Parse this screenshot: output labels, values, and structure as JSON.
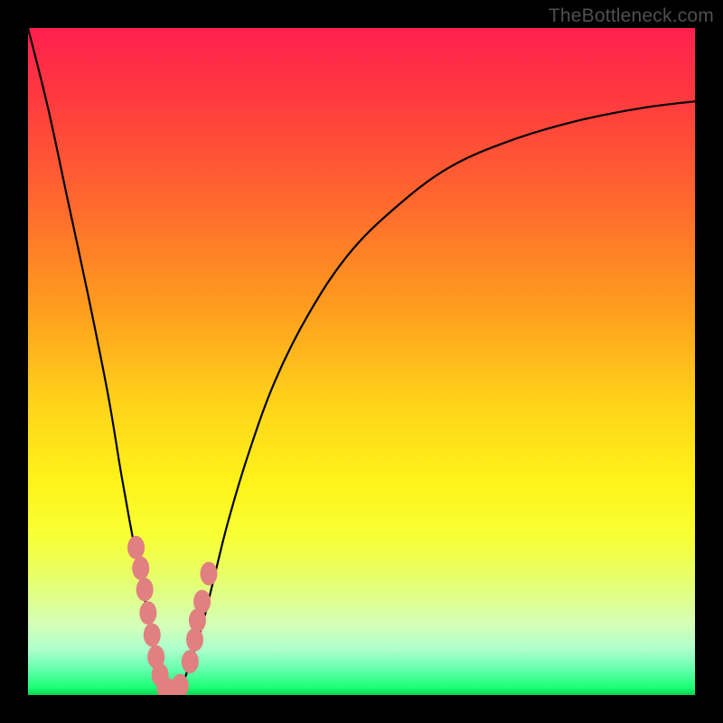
{
  "watermark": "TheBottleneck.com",
  "chart_data": {
    "type": "line",
    "title": "",
    "xlabel": "",
    "ylabel": "",
    "xlim": [
      0,
      100
    ],
    "ylim": [
      0,
      100
    ],
    "grid": false,
    "legend": false,
    "series": [
      {
        "name": "bottleneck-curve",
        "x": [
          0,
          3,
          6,
          9,
          12,
          14,
          16,
          18,
          19.5,
          21,
          22,
          23,
          24,
          26,
          28,
          30,
          33,
          37,
          42,
          48,
          55,
          63,
          72,
          82,
          92,
          100
        ],
        "y": [
          100,
          88,
          74,
          60,
          45,
          33,
          22,
          12,
          5,
          1,
          0,
          1,
          4,
          10,
          18,
          26,
          36,
          47,
          57,
          66,
          73,
          79,
          83,
          86,
          88,
          89
        ]
      }
    ],
    "markers": [
      {
        "name": "cluster-left",
        "points": [
          {
            "x": 16.2,
            "y": 22.1
          },
          {
            "x": 16.9,
            "y": 19.0
          },
          {
            "x": 17.5,
            "y": 15.8
          },
          {
            "x": 18.0,
            "y": 12.3
          },
          {
            "x": 18.6,
            "y": 9.0
          },
          {
            "x": 19.2,
            "y": 5.7
          },
          {
            "x": 19.8,
            "y": 3.0
          }
        ]
      },
      {
        "name": "cluster-right",
        "points": [
          {
            "x": 24.3,
            "y": 5.0
          },
          {
            "x": 25.0,
            "y": 8.3
          },
          {
            "x": 25.4,
            "y": 11.2
          },
          {
            "x": 26.1,
            "y": 14.0
          },
          {
            "x": 27.1,
            "y": 18.2
          }
        ]
      },
      {
        "name": "cluster-bottom",
        "points": [
          {
            "x": 20.6,
            "y": 1.0
          },
          {
            "x": 21.7,
            "y": 0.6
          },
          {
            "x": 22.8,
            "y": 1.4
          }
        ]
      }
    ],
    "colors": {
      "curve": "#000000",
      "marker_fill": "#e08080",
      "marker_stroke": "#bd5b5b"
    }
  }
}
